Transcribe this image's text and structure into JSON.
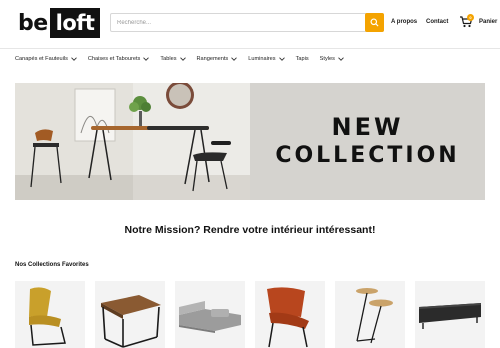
{
  "header": {
    "logo_prefix": "be",
    "logo_box": "loft",
    "search_placeholder": "Recherche...",
    "links": [
      "A propos",
      "Contact"
    ],
    "cart_label": "Panier",
    "cart_count": "0",
    "accent_color": "#f4a300"
  },
  "nav": {
    "items": [
      {
        "label": "Canapés et Fauteuils",
        "has_dropdown": true
      },
      {
        "label": "Chaises et Tabourets",
        "has_dropdown": true
      },
      {
        "label": "Tables",
        "has_dropdown": true
      },
      {
        "label": "Rangements",
        "has_dropdown": true
      },
      {
        "label": "Luminaires",
        "has_dropdown": true
      },
      {
        "label": "Tapis",
        "has_dropdown": false
      },
      {
        "label": "Styles",
        "has_dropdown": true
      }
    ]
  },
  "banner": {
    "line1": "NEW",
    "line2": "COLLECTION"
  },
  "mission": "Notre Mission? Rendre votre intérieur intéressant!",
  "collections": {
    "title": "Nos Collections Favorites",
    "items": [
      "chair-icon",
      "table-icon",
      "sofa-icon",
      "armchair-icon",
      "side-table-icon",
      "tv-stand-icon"
    ]
  }
}
